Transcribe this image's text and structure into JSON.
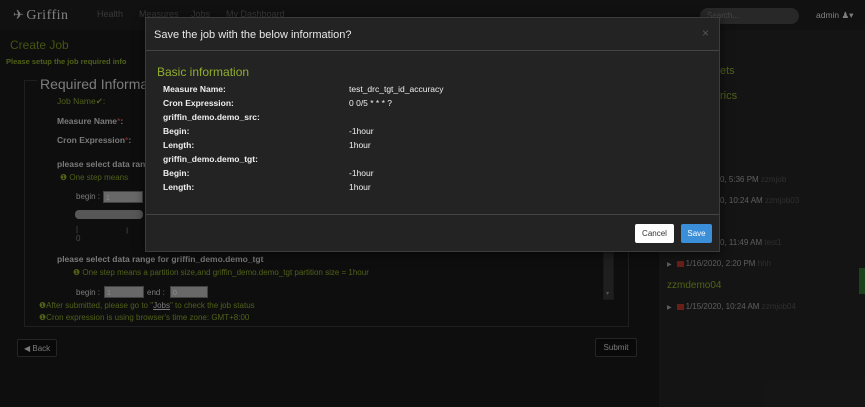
{
  "app": {
    "brand": "Griffin"
  },
  "nav": [
    "Health",
    "Measures",
    "Jobs",
    "My Dashboard"
  ],
  "search": {
    "placeholder": "Search..."
  },
  "user": {
    "name": "admin"
  },
  "page": {
    "title": "Create Job",
    "hint": "Please setup the job required info",
    "panel_title": "Required Informati",
    "job_name_label": "Job Name",
    "measure_name_label": "Measure Name",
    "cron_label": "Cron Expression",
    "range_src_label": "please select data rang",
    "step_src": "One step means",
    "begin_label": "begin :",
    "begin_src_value": "1",
    "tick_zero": "0",
    "range_tgt_label": "please select data range for griffin_demo.demo_tgt",
    "step_tgt": "One step means a partition size,and griffin_demo.demo_tgt partition size = 1hour",
    "begin_tgt_value": "1",
    "end_label": "end :",
    "end_tgt_value": "0",
    "after_note_1": "After submitted, please go to \"",
    "after_note_link": "Jobs",
    "after_note_2": "\" to check the job status",
    "tz_note": "Cron expression is using browser's time zone: GMT+8:00",
    "back": "Back",
    "submit": "Submit"
  },
  "right_panel": {
    "heading_a": "ets",
    "heading_b": "rics",
    "items": [
      {
        "time": "0, 5:36 PM",
        "job": "zzmjob"
      },
      {
        "time": "0, 10:24 AM",
        "job": "zzmjob03"
      },
      {
        "time": "0, 11:49 AM",
        "job": "test1"
      },
      {
        "time": "1/16/2020, 2:20 PM",
        "job": "hhh"
      }
    ],
    "group": "zzmdemo04",
    "group_item": {
      "time": "1/15/2020, 10:24 AM",
      "job": "zzmjob04"
    }
  },
  "modal": {
    "title": "Save the job with the below information?",
    "close": "×",
    "section": "Basic information",
    "rows": [
      {
        "label": "Measure Name:",
        "value": "test_drc_tgt_id_accuracy"
      },
      {
        "label": "Cron Expression:",
        "value": "0 0/5 * * * ?"
      },
      {
        "label": "griffin_demo.demo_src:",
        "value": ""
      },
      {
        "label": "Begin:",
        "value": "-1hour"
      },
      {
        "label": "Length:",
        "value": "1hour"
      },
      {
        "label": "griffin_demo.demo_tgt:",
        "value": ""
      },
      {
        "label": "Begin:",
        "value": "-1hour"
      },
      {
        "label": "Length:",
        "value": "1hour"
      }
    ],
    "cancel": "Cancel",
    "save": "Save"
  }
}
